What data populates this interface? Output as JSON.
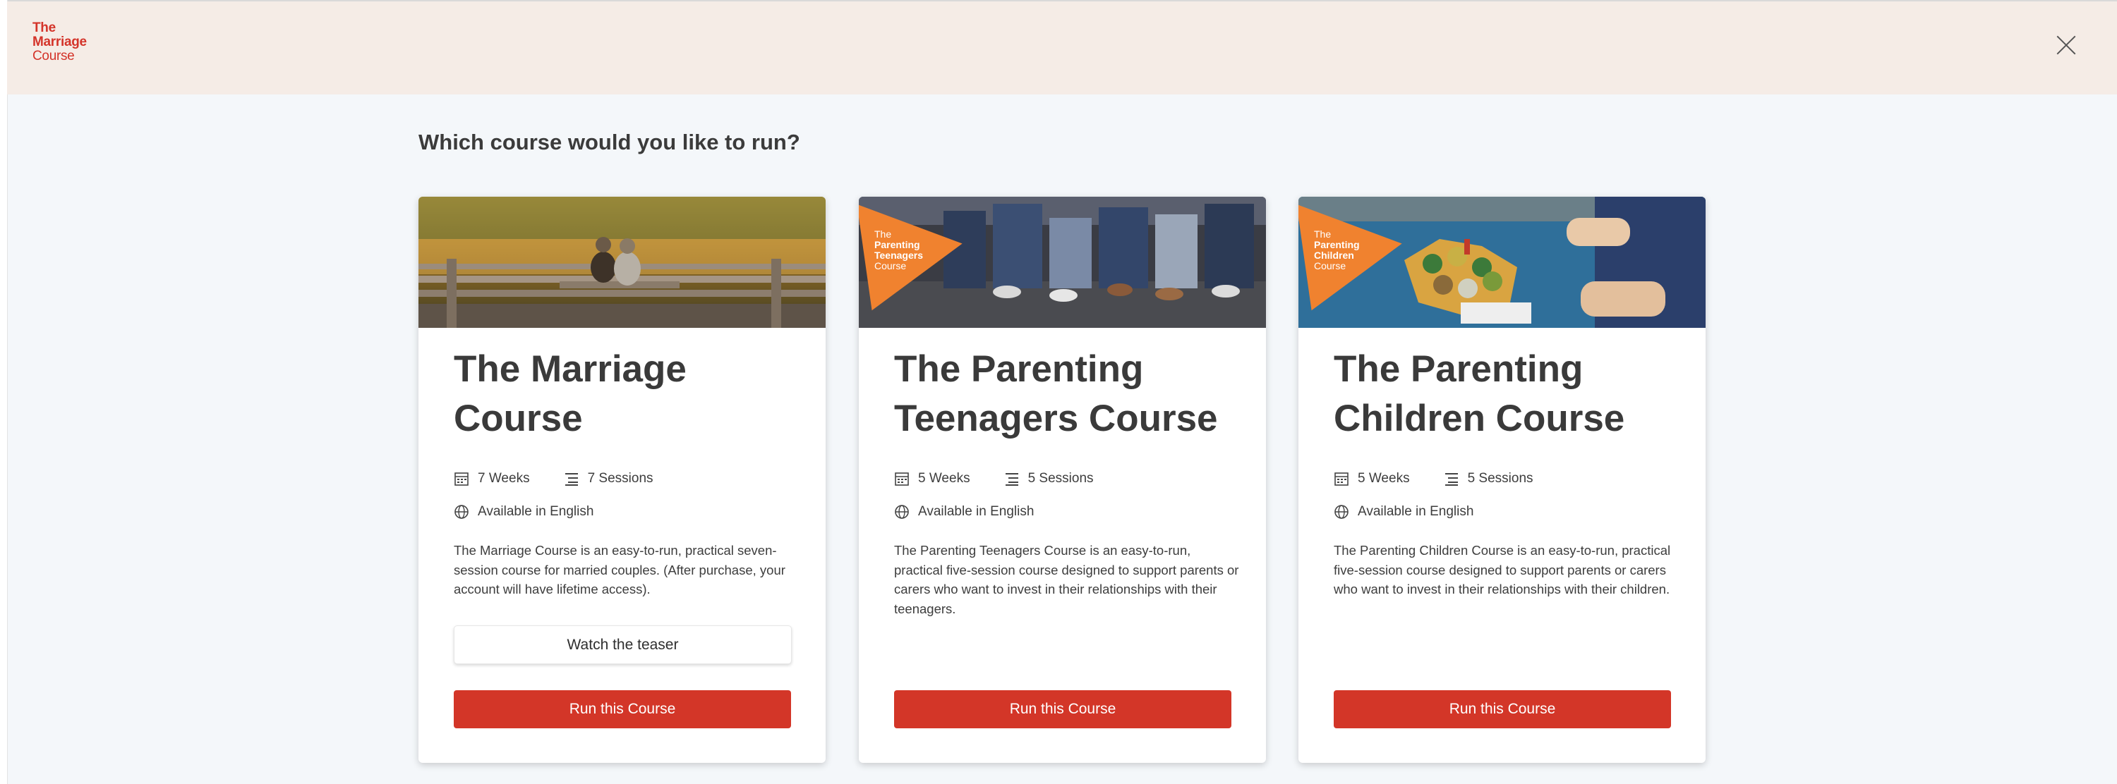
{
  "header": {
    "logo": {
      "line1": "The",
      "line2": "Marriage",
      "line3": "Course"
    },
    "close_icon": "close-icon"
  },
  "page": {
    "title": "Which course would you like to run?"
  },
  "colors": {
    "brand_red": "#d33628",
    "header_bg": "#f5ece6",
    "badge_orange": "#f0822f"
  },
  "cards": [
    {
      "title": "The Marriage Course",
      "weeks": "7 Weeks",
      "sessions": "7 Sessions",
      "language": "Available in English",
      "description": "The Marriage Course is an easy-to-run, practical seven-session course for married couples. (After purchase, your account will have lifetime access).",
      "teaser_label": "Watch the teaser",
      "run_label": "Run this Course"
    },
    {
      "title": "The Parenting Teenagers Course",
      "badge": {
        "line1": "The",
        "line2": "Parenting",
        "line3": "Teenagers",
        "line4": "Course"
      },
      "weeks": "5 Weeks",
      "sessions": "5 Sessions",
      "language": "Available in English",
      "description": "The Parenting Teenagers Course is an easy-to-run, practical five-session course designed to support parents or carers who want to invest in their relationships with their teenagers.",
      "run_label": "Run this Course"
    },
    {
      "title": "The Parenting Children Course",
      "badge": {
        "line1": "The",
        "line2": "Parenting",
        "line3": "Children",
        "line4": "Course"
      },
      "weeks": "5 Weeks",
      "sessions": "5 Sessions",
      "language": "Available in English",
      "description": "The Parenting Children Course is an easy-to-run, practical five-session course designed to support parents or carers who want to invest in their relationships with their children.",
      "run_label": "Run this Course"
    }
  ]
}
